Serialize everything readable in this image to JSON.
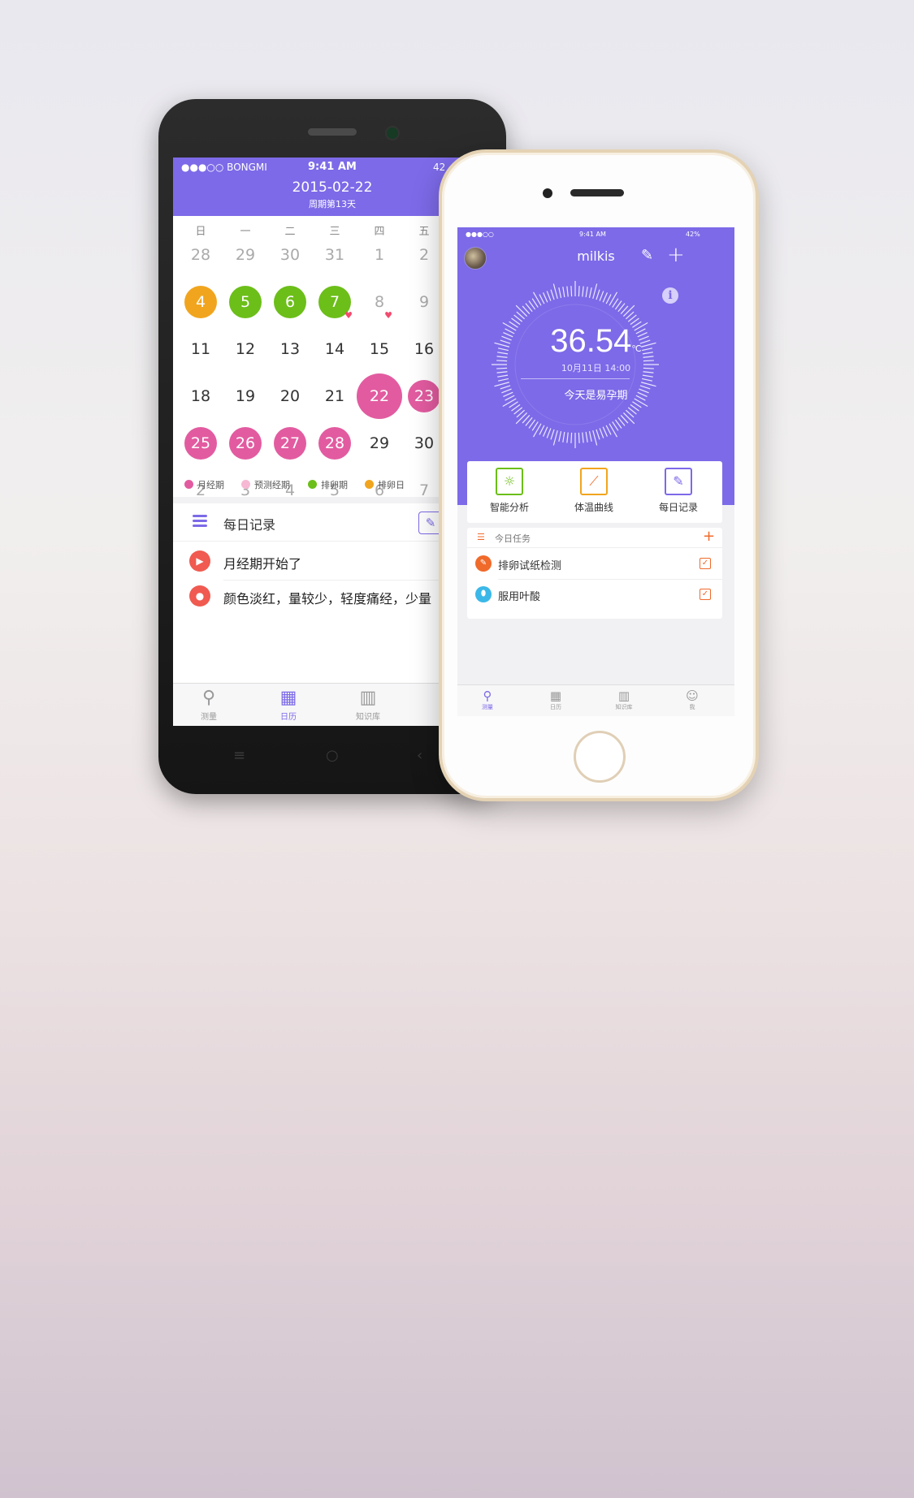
{
  "android": {
    "status": {
      "carrier": "●●●○○ BONGMI",
      "time": "9:41 AM",
      "battery": "42"
    },
    "header": {
      "date": "2015-02-22",
      "cycle": "周期第13天"
    },
    "weekdays": [
      "日",
      "一",
      "二",
      "三",
      "四",
      "五"
    ],
    "calendar": [
      [
        "28",
        "29",
        "30",
        "31",
        "1",
        "2"
      ],
      [
        "4",
        "5",
        "6",
        "7",
        "8",
        "9"
      ],
      [
        "11",
        "12",
        "13",
        "14",
        "15",
        "16"
      ],
      [
        "18",
        "19",
        "20",
        "21",
        "22",
        "23"
      ],
      [
        "25",
        "26",
        "27",
        "28",
        "29",
        "30"
      ],
      [
        "2",
        "3",
        "4",
        "5",
        "6",
        "7"
      ]
    ],
    "legend": [
      {
        "label": "月经期",
        "color": "#e25ba0"
      },
      {
        "label": "预测经期",
        "color": "#f7b8d3"
      },
      {
        "label": "排卵期",
        "color": "#6cbe19"
      },
      {
        "label": "排卵日",
        "color": "#f1a51e"
      }
    ],
    "records": {
      "title": "每日记录",
      "items": [
        "月经期开始了",
        "颜色淡红，量较少，轻度痛经，少量"
      ]
    },
    "tabs": [
      "测量",
      "日历",
      "知识库"
    ],
    "active_tab": "日历"
  },
  "iphone": {
    "status": {
      "carrier": "●●●○○",
      "time": "9:41 AM",
      "battery": "42%"
    },
    "nav": {
      "name": "milkis"
    },
    "temperature": {
      "value": "36.54",
      "unit": "℃",
      "datetime": "10月11日 14:00",
      "status": "今天是易孕期"
    },
    "actions": [
      "智能分析",
      "体温曲线",
      "每日记录"
    ],
    "tasks": {
      "title": "今日任务",
      "items": [
        "排卵试纸检测",
        "服用叶酸"
      ]
    },
    "tabs": [
      "测量",
      "日历",
      "知识库",
      "我"
    ],
    "active_tab": "测量"
  },
  "colors": {
    "accent": "#7c6ae8",
    "period": "#e25ba0",
    "ovulation": "#6cbe19",
    "ovulation_day": "#f1a51e",
    "task_orange": "#f06a2a"
  }
}
